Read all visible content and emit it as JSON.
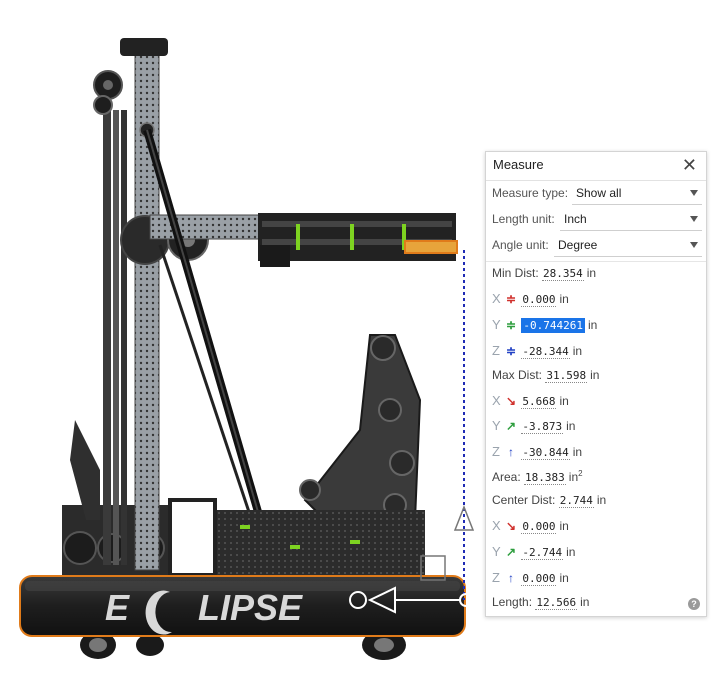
{
  "panel": {
    "title": "Measure",
    "close_glyph": "✕",
    "measure_type_label": "Measure type:",
    "measure_type_value": "Show all",
    "length_unit_label": "Length unit:",
    "length_unit_value": "Inch",
    "angle_unit_label": "Angle unit:",
    "angle_unit_value": "Degree",
    "rows": {
      "min_dist": {
        "label": "Min Dist:",
        "value": "28.354",
        "unit": "in"
      },
      "min_x": {
        "axis": "X",
        "value": "0.000",
        "unit": "in"
      },
      "min_y": {
        "axis": "Y",
        "value": "-0.744261",
        "unit": "in"
      },
      "min_z": {
        "axis": "Z",
        "value": "-28.344",
        "unit": "in"
      },
      "max_dist": {
        "label": "Max Dist:",
        "value": "31.598",
        "unit": "in"
      },
      "max_x": {
        "axis": "X",
        "value": "5.668",
        "unit": "in"
      },
      "max_y": {
        "axis": "Y",
        "value": "-3.873",
        "unit": "in"
      },
      "max_z": {
        "axis": "Z",
        "value": "-30.844",
        "unit": "in"
      },
      "area": {
        "label": "Area:",
        "value": "18.383",
        "unit": "in",
        "sup": "2"
      },
      "center_dist": {
        "label": "Center Dist:",
        "value": "2.744",
        "unit": "in"
      },
      "center_x": {
        "axis": "X",
        "value": "0.000",
        "unit": "in"
      },
      "center_y": {
        "axis": "Y",
        "value": "-2.744",
        "unit": "in"
      },
      "center_z": {
        "axis": "Z",
        "value": "0.000",
        "unit": "in"
      },
      "length": {
        "label": "Length:",
        "value": "12.566",
        "unit": "in"
      }
    },
    "help_glyph": "?"
  },
  "model": {
    "logo_text": "ECLIPSE",
    "logo_letter_parts": [
      "E",
      "LIPSE"
    ]
  },
  "colors": {
    "x_axis": "#d0312d",
    "y_axis": "#2e9e3e",
    "z_axis": "#2342c4",
    "highlight": "#1a74e8",
    "selection_orange": "#e07b1a",
    "measure_line": "#1f2bb5",
    "green_parts": "#7ed321"
  },
  "icons": {
    "min_delta": "equal-bars-icon",
    "max_x": "arrow-down-right-icon",
    "max_y": "arrow-up-right-icon",
    "max_z": "arrow-up-icon",
    "help": "help-icon",
    "close": "close-icon"
  }
}
